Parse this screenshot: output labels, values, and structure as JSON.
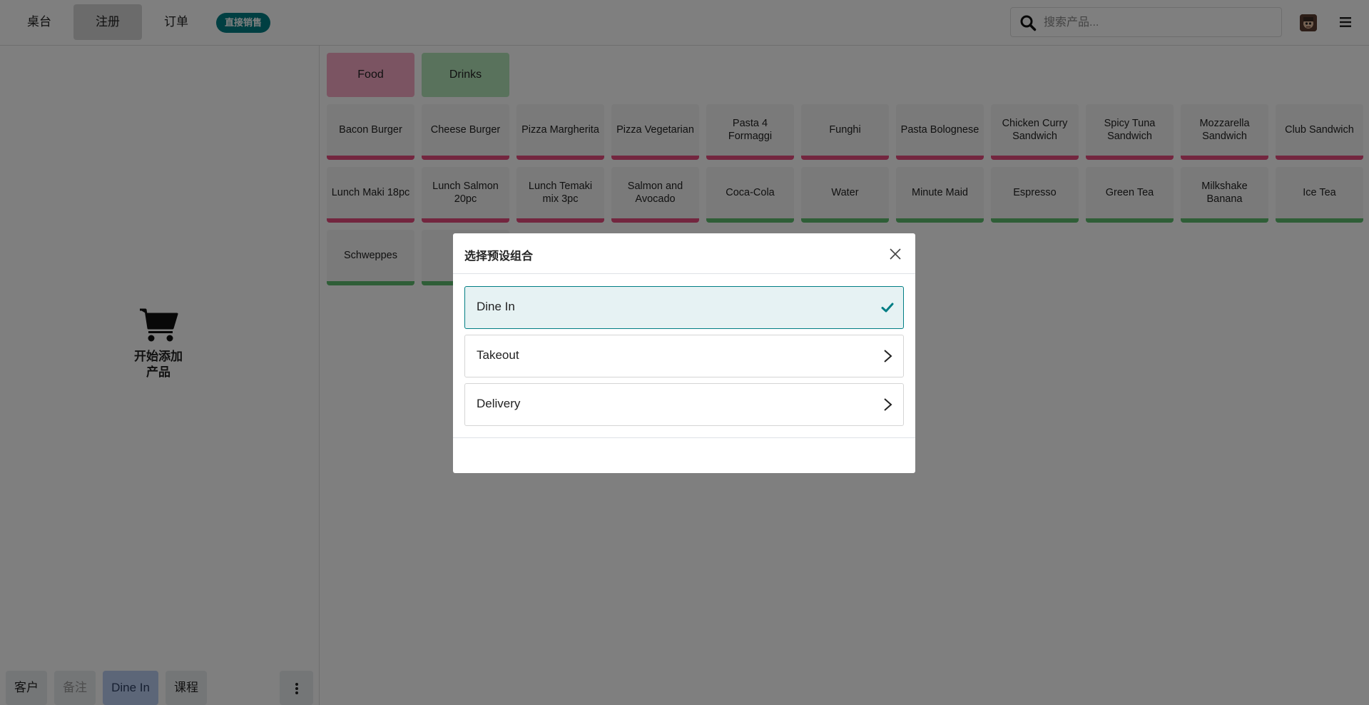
{
  "topbar": {
    "tabs": [
      {
        "label": "桌台"
      },
      {
        "label": "注册"
      },
      {
        "label": "订单"
      }
    ],
    "badge": "直接销售",
    "search": {
      "placeholder": "搜索产品..."
    }
  },
  "left": {
    "empty_text_line1": "开始添加",
    "empty_text_line2": "产品",
    "bottom": {
      "customer": "客户",
      "note": "备注",
      "preset": "Dine In",
      "course": "课程"
    }
  },
  "categories": [
    {
      "label": "Food",
      "color": "#f7a8c4"
    },
    {
      "label": "Drinks",
      "color": "#b3e4b9"
    }
  ],
  "products": {
    "row1": [
      "Bacon Burger",
      "Cheese Burger",
      "Pizza Margherita",
      "Pizza Vegetarian",
      "Pasta 4 Formaggi",
      "Funghi",
      "Pasta Bolognese",
      "Chicken Curry Sandwich",
      "Spicy Tuna Sandwich",
      "Mozzarella Sandwich",
      "Club Sandwich"
    ],
    "row2": [
      "Lunch Maki 18pc",
      "Lunch Salmon 20pc",
      "Lunch Temaki mix 3pc",
      "Salmon and Avocado",
      "Coca-Cola",
      "Water",
      "Minute Maid",
      "Espresso",
      "Green Tea",
      "Milkshake Banana",
      "Ice Tea"
    ],
    "row3": [
      "Schweppes"
    ]
  },
  "modal": {
    "title": "选择预设组合",
    "options": [
      {
        "label": "Dine In",
        "selected": true
      },
      {
        "label": "Takeout",
        "selected": false
      },
      {
        "label": "Delivery",
        "selected": false
      }
    ]
  },
  "colors": {
    "accent": "#017e84",
    "food_border": "#e64d7f",
    "drink_border": "#5fbd6e"
  }
}
